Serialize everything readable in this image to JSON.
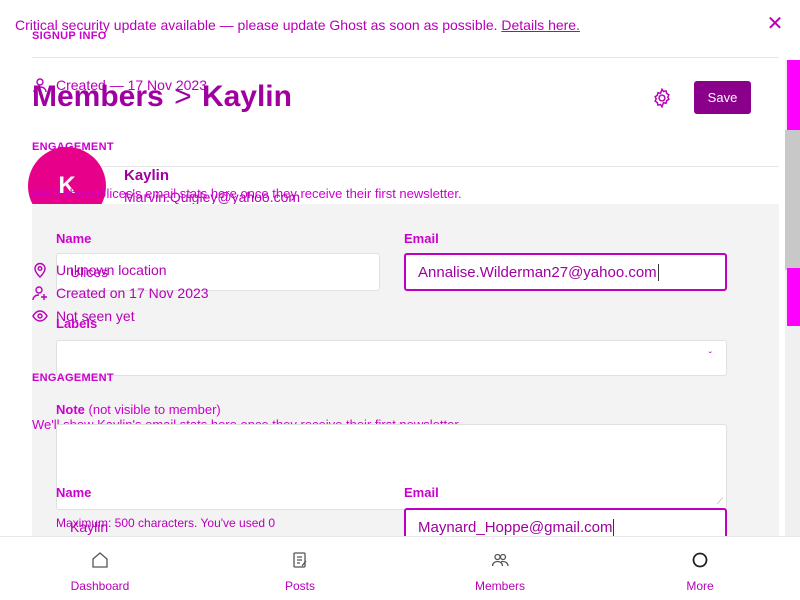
{
  "banner": {
    "message": "Critical security update available — please update Ghost as soon as possible.",
    "link_text": "Details here."
  },
  "header": {
    "breadcrumb_root": "Members",
    "separator": ">",
    "breadcrumb_current": "Kaylin",
    "save_label": "Save"
  },
  "overlay": {
    "signup_info_label": "SIGNUP INFO",
    "created_text": "Created — 17 Nov 2023",
    "engagement_label_top": "ENGAGEMENT",
    "engagement_note_top": "We'll show Ulices's email stats here once they receive their first newsletter.",
    "engagement_label_mid": "ENGAGEMENT",
    "engagement_note_mid": "We'll show Kaylin's email stats here once they receive their first newsletter.",
    "ghost_name_value": "Ulices",
    "ghost_name_value_2": "Kaylin"
  },
  "member": {
    "avatar_initial": "K",
    "name": "Kaylin",
    "email": "Marvin.Quigley@yahoo.com",
    "location": "Unknown location",
    "created": "Created on 17 Nov 2023",
    "last_seen": "Not seen yet"
  },
  "form": {
    "name_label": "Name",
    "email_label": "Email",
    "email_value": "Annalise.Wilderman27@yahoo.com",
    "labels_label": "Labels",
    "note_label": "Note",
    "note_hint": "(not visible to member)",
    "char_count": "Maximum: 500 characters. You've used 0",
    "name_label_2": "Name",
    "email_label_2": "Email",
    "email_value_2": "Maynard_Hoppe@gmail.com"
  },
  "nav": {
    "items": [
      {
        "label": "Dashboard",
        "icon": "home-icon"
      },
      {
        "label": "Posts",
        "icon": "posts-icon"
      },
      {
        "label": "Members",
        "icon": "members-icon"
      },
      {
        "label": "More",
        "icon": "more-icon"
      }
    ]
  },
  "colors": {
    "accent": "#cc00cc",
    "save_button": "#8a008a",
    "avatar": "#e6008a"
  }
}
